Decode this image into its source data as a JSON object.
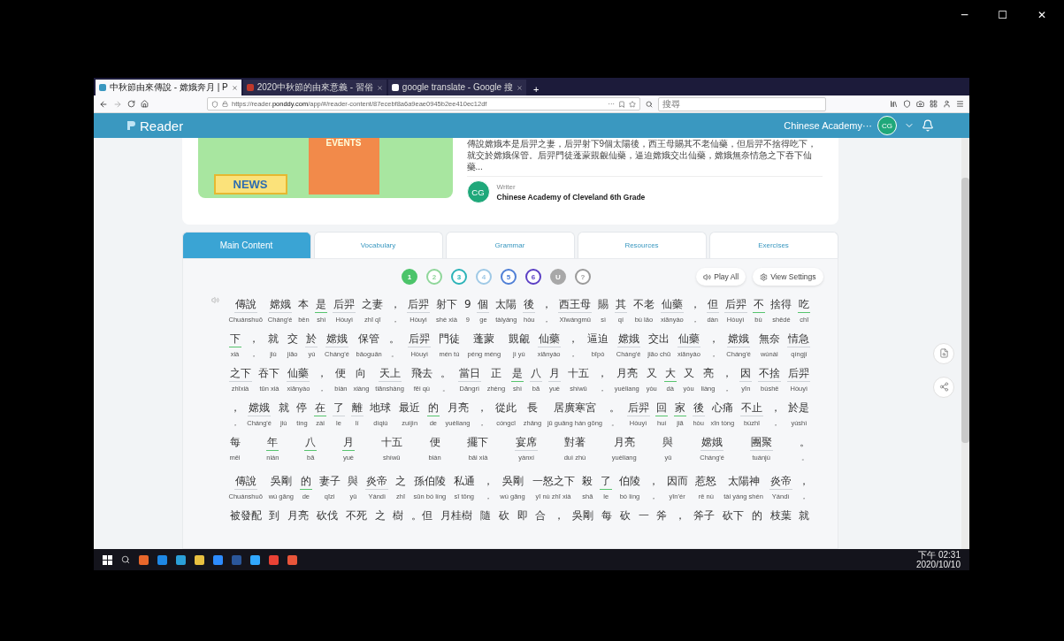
{
  "window_controls": [
    "─",
    "☐",
    "✕"
  ],
  "browser": {
    "tabs": [
      {
        "title": "中秋節由來傳說 - 嫦娥奔月 | P",
        "selected": true
      },
      {
        "title": "2020中秋節的由來意義 - 習俗",
        "selected": false
      },
      {
        "title": "google translate - Google 搜",
        "selected": false
      }
    ],
    "new_tab": "+",
    "url_prefix": "https://reader.",
    "url_domain": "ponddy.com",
    "url_path": "/app/#/reader-content/87ecebf8a6a9eae0945b2ee410ec12df",
    "more": "···",
    "search": {
      "placeholder": "搜尋"
    }
  },
  "header": {
    "logo": "Reader",
    "user": "Chinese Academy···",
    "avatar": "CG"
  },
  "article": {
    "illustration": [
      "NEWS",
      "EVENTS"
    ],
    "summary": "傳說嫦娥本是后羿之妻，后羿射下9個太陽後，西王母賜其不老仙藥，但后羿不捨得吃下，就交於嫦娥保管。后羿門徒蓬蒙覬覦仙藥，逼迫嫦娥交出仙藥，嫦娥無奈情急之下吞下仙藥...",
    "writer_label": "Writer",
    "writer_avatar": "CG",
    "writer": "Chinese Academy of Cleveland 6th Grade"
  },
  "tabs": [
    {
      "label": "Main Content",
      "selected": true
    },
    {
      "label": "Vocabulary",
      "selected": false
    },
    {
      "label": "Grammar",
      "selected": false
    },
    {
      "label": "Resources",
      "selected": false
    },
    {
      "label": "Exercises",
      "selected": false
    }
  ],
  "levels": [
    {
      "label": "1",
      "color": "#4cc46a",
      "selected": true
    },
    {
      "label": "2",
      "color": "#8fd69a",
      "selected": false
    },
    {
      "label": "3",
      "color": "#2bb3b8",
      "selected": false
    },
    {
      "label": "4",
      "color": "#9fc9e6",
      "selected": false
    },
    {
      "label": "5",
      "color": "#4f7fd6",
      "selected": false
    },
    {
      "label": "6",
      "color": "#5b3fc4",
      "selected": false
    },
    {
      "label": "U",
      "color": "#a8a8a8",
      "selected": true
    },
    {
      "label": "?",
      "color": "#9a9a9a",
      "selected": false
    }
  ],
  "play_all": "Play All",
  "view_settings": "View Settings",
  "paragraphs": [
    {
      "lines": [
        [
          {
            "h": "傳說",
            "p": "Chuánshuō",
            "kind": "vocab"
          },
          {
            "h": "嫦娥",
            "p": "Cháng'é",
            "kind": "vocab"
          },
          {
            "h": "本",
            "p": "běn",
            "kind": "plain"
          },
          {
            "h": "是",
            "p": "shì",
            "kind": "grammar"
          },
          {
            "h": "后羿",
            "p": "Hòuyì",
            "kind": "vocab"
          },
          {
            "h": "之妻",
            "p": "zhī qī",
            "kind": "plain"
          },
          {
            "h": "，",
            "p": "，",
            "kind": "plain"
          },
          {
            "h": "后羿",
            "p": "Hòuyì",
            "kind": "vocab"
          },
          {
            "h": "射下",
            "p": "shè xià",
            "kind": "plain"
          },
          {
            "h": "9",
            "p": "9",
            "kind": "plain"
          },
          {
            "h": "個",
            "p": "ge",
            "kind": "vocab"
          },
          {
            "h": "太陽",
            "p": "tàiyáng",
            "kind": "plain"
          },
          {
            "h": "後",
            "p": "hòu",
            "kind": "vocab"
          },
          {
            "h": "，",
            "p": "，",
            "kind": "plain"
          },
          {
            "h": "西王母",
            "p": "Xīwángmǔ",
            "kind": "vocab"
          },
          {
            "h": "賜",
            "p": "sì",
            "kind": "plain"
          },
          {
            "h": "其",
            "p": "qí",
            "kind": "vocab"
          },
          {
            "h": "不老",
            "p": "bù lǎo",
            "kind": "plain"
          },
          {
            "h": "仙藥",
            "p": "xiānyào",
            "kind": "vocab"
          },
          {
            "h": "，",
            "p": "，",
            "kind": "plain"
          },
          {
            "h": "但",
            "p": "dàn",
            "kind": "vocab"
          },
          {
            "h": "后羿",
            "p": "Hòuyì",
            "kind": "vocab"
          },
          {
            "h": "不",
            "p": "bù",
            "kind": "grammar"
          },
          {
            "h": "捨得",
            "p": "shědé",
            "kind": "plain"
          },
          {
            "h": "吃",
            "p": "chī",
            "kind": "grammar"
          }
        ],
        [
          {
            "h": "下",
            "p": "xià",
            "kind": "grammar"
          },
          {
            "h": "，",
            "p": "，",
            "kind": "plain"
          },
          {
            "h": "就",
            "p": "jiù",
            "kind": "plain"
          },
          {
            "h": "交",
            "p": "jiāo",
            "kind": "plain"
          },
          {
            "h": "於",
            "p": "yú",
            "kind": "vocab"
          },
          {
            "h": "嫦娥",
            "p": "Cháng'é",
            "kind": "vocab"
          },
          {
            "h": "保管",
            "p": "bǎoguǎn",
            "kind": "plain"
          },
          {
            "h": "。",
            "p": "。",
            "kind": "plain"
          },
          {
            "h": "后羿",
            "p": "Hòuyì",
            "kind": "vocab"
          },
          {
            "h": "門徒",
            "p": "mén tú",
            "kind": "plain"
          },
          {
            "h": "蓬蒙",
            "p": "péng méng",
            "kind": "plain"
          },
          {
            "h": "覬覦",
            "p": "jì yú",
            "kind": "plain"
          },
          {
            "h": "仙藥",
            "p": "xiānyào",
            "kind": "vocab"
          },
          {
            "h": "，",
            "p": "，",
            "kind": "plain"
          },
          {
            "h": "逼迫",
            "p": "bīpò",
            "kind": "plain"
          },
          {
            "h": "嫦娥",
            "p": "Cháng'é",
            "kind": "vocab"
          },
          {
            "h": "交出",
            "p": "jiāo chū",
            "kind": "plain"
          },
          {
            "h": "仙藥",
            "p": "xiānyào",
            "kind": "vocab"
          },
          {
            "h": "，",
            "p": "，",
            "kind": "plain"
          },
          {
            "h": "嫦娥",
            "p": "Cháng'é",
            "kind": "vocab"
          },
          {
            "h": "無奈",
            "p": "wúnài",
            "kind": "plain"
          },
          {
            "h": "情急",
            "p": "qíngjí",
            "kind": "vocab"
          }
        ],
        [
          {
            "h": "之下",
            "p": "zhīxià",
            "kind": "vocab"
          },
          {
            "h": "吞下",
            "p": "tūn xià",
            "kind": "plain"
          },
          {
            "h": "仙藥",
            "p": "xiānyào",
            "kind": "vocab"
          },
          {
            "h": "，",
            "p": "，",
            "kind": "plain"
          },
          {
            "h": "便",
            "p": "biàn",
            "kind": "plain"
          },
          {
            "h": "向",
            "p": "xiàng",
            "kind": "plain"
          },
          {
            "h": "天上",
            "p": "tiānshàng",
            "kind": "vocab"
          },
          {
            "h": "飛去",
            "p": "fēi qù",
            "kind": "plain"
          },
          {
            "h": "。",
            "p": "。",
            "kind": "plain"
          },
          {
            "h": "當日",
            "p": "Dāngrì",
            "kind": "vocab"
          },
          {
            "h": "正",
            "p": "zhèng",
            "kind": "plain"
          },
          {
            "h": "是",
            "p": "shì",
            "kind": "grammar"
          },
          {
            "h": "八",
            "p": "bā",
            "kind": "vocab"
          },
          {
            "h": "月",
            "p": "yuè",
            "kind": "vocab"
          },
          {
            "h": "十五",
            "p": "shíwǔ",
            "kind": "plain"
          },
          {
            "h": "，",
            "p": "，",
            "kind": "plain"
          },
          {
            "h": "月亮",
            "p": "yuèliang",
            "kind": "plain"
          },
          {
            "h": "又",
            "p": "yòu",
            "kind": "plain"
          },
          {
            "h": "大",
            "p": "dà",
            "kind": "grammar"
          },
          {
            "h": "又",
            "p": "yòu",
            "kind": "plain"
          },
          {
            "h": "亮",
            "p": "liàng",
            "kind": "plain"
          },
          {
            "h": "，",
            "p": "，",
            "kind": "plain"
          },
          {
            "h": "因",
            "p": "yīn",
            "kind": "vocab"
          },
          {
            "h": "不捨",
            "p": "bùshě",
            "kind": "vocab"
          },
          {
            "h": "后羿",
            "p": "Hòuyì",
            "kind": "vocab"
          }
        ],
        [
          {
            "h": "，",
            "p": "，",
            "kind": "plain"
          },
          {
            "h": "嫦娥",
            "p": "Cháng'é",
            "kind": "vocab"
          },
          {
            "h": "就",
            "p": "jiù",
            "kind": "plain"
          },
          {
            "h": "停",
            "p": "tíng",
            "kind": "plain"
          },
          {
            "h": "在",
            "p": "zài",
            "kind": "grammar"
          },
          {
            "h": "了",
            "p": "le",
            "kind": "vocab"
          },
          {
            "h": "離",
            "p": "lí",
            "kind": "vocab"
          },
          {
            "h": "地球",
            "p": "dìqiú",
            "kind": "plain"
          },
          {
            "h": "最近",
            "p": "zuìjìn",
            "kind": "plain"
          },
          {
            "h": "的",
            "p": "de",
            "kind": "grammar"
          },
          {
            "h": "月亮",
            "p": "yuèliang",
            "kind": "plain"
          },
          {
            "h": "，",
            "p": "，",
            "kind": "plain"
          },
          {
            "h": "從此",
            "p": "cóngcǐ",
            "kind": "plain"
          },
          {
            "h": "長",
            "p": "zhǎng",
            "kind": "plain"
          },
          {
            "h": "居廣寒宮",
            "p": "jū guǎng hán gōng",
            "kind": "plain"
          },
          {
            "h": "。",
            "p": "。",
            "kind": "plain"
          },
          {
            "h": "后羿",
            "p": "Hòuyì",
            "kind": "vocab"
          },
          {
            "h": "回",
            "p": "huí",
            "kind": "grammar"
          },
          {
            "h": "家",
            "p": "jiā",
            "kind": "grammar"
          },
          {
            "h": "後",
            "p": "hòu",
            "kind": "vocab"
          },
          {
            "h": "心痛",
            "p": "xīn tòng",
            "kind": "plain"
          },
          {
            "h": "不止",
            "p": "bùzhǐ",
            "kind": "vocab"
          },
          {
            "h": "，",
            "p": "，",
            "kind": "plain"
          },
          {
            "h": "於是",
            "p": "yúshì",
            "kind": "plain"
          }
        ],
        [
          {
            "h": "每",
            "p": "měi",
            "kind": "plain"
          },
          {
            "h": "年",
            "p": "nián",
            "kind": "grammar"
          },
          {
            "h": "八",
            "p": "bā",
            "kind": "grammar"
          },
          {
            "h": "月",
            "p": "yuè",
            "kind": "grammar"
          },
          {
            "h": "十五",
            "p": "shíwǔ",
            "kind": "plain"
          },
          {
            "h": "便",
            "p": "biàn",
            "kind": "plain"
          },
          {
            "h": "擺下",
            "p": "bǎi xià",
            "kind": "plain"
          },
          {
            "h": "宴席",
            "p": "yànxí",
            "kind": "vocab"
          },
          {
            "h": "對著",
            "p": "duì zhù",
            "kind": "plain"
          },
          {
            "h": "月亮",
            "p": "yuèliang",
            "kind": "plain"
          },
          {
            "h": "與",
            "p": "yǔ",
            "kind": "plain"
          },
          {
            "h": "嫦娥",
            "p": "Cháng'é",
            "kind": "vocab"
          },
          {
            "h": "團聚",
            "p": "tuánjù",
            "kind": "vocab"
          },
          {
            "h": "。",
            "p": "。",
            "kind": "plain"
          }
        ]
      ]
    },
    {
      "lines": [
        [
          {
            "h": "傳說",
            "p": "Chuánshuō",
            "kind": "vocab"
          },
          {
            "h": "吳剛",
            "p": "wú gāng",
            "kind": "plain"
          },
          {
            "h": "的",
            "p": "de",
            "kind": "grammar"
          },
          {
            "h": "妻子",
            "p": "qīzi",
            "kind": "plain"
          },
          {
            "h": "與",
            "p": "yǔ",
            "kind": "plain"
          },
          {
            "h": "炎帝",
            "p": "Yándì",
            "kind": "vocab"
          },
          {
            "h": "之",
            "p": "zhī",
            "kind": "plain"
          },
          {
            "h": "孫伯陵",
            "p": "sūn bó líng",
            "kind": "plain"
          },
          {
            "h": "私通",
            "p": "sī tōng",
            "kind": "plain"
          },
          {
            "h": "，",
            "p": "，",
            "kind": "plain"
          },
          {
            "h": "吳剛",
            "p": "wú gāng",
            "kind": "plain"
          },
          {
            "h": "一怒之下",
            "p": "yī nù zhī xià",
            "kind": "plain"
          },
          {
            "h": "殺",
            "p": "shā",
            "kind": "plain"
          },
          {
            "h": "了",
            "p": "le",
            "kind": "grammar"
          },
          {
            "h": "伯陵",
            "p": "bó líng",
            "kind": "plain"
          },
          {
            "h": "，",
            "p": "，",
            "kind": "plain"
          },
          {
            "h": "因而",
            "p": "yīn'ér",
            "kind": "plain"
          },
          {
            "h": "惹怒",
            "p": "rě nù",
            "kind": "plain"
          },
          {
            "h": "太陽神",
            "p": "tài yáng shén",
            "kind": "plain"
          },
          {
            "h": "炎帝",
            "p": "Yándì",
            "kind": "vocab"
          },
          {
            "h": "，",
            "p": "，",
            "kind": "plain"
          }
        ],
        [
          {
            "h": "被發配",
            "kind": "plain"
          },
          {
            "h": "到",
            "kind": "plain"
          },
          {
            "h": "月亮",
            "kind": "plain"
          },
          {
            "h": "砍伐",
            "kind": "plain"
          },
          {
            "h": "不死",
            "kind": "plain"
          },
          {
            "h": "之",
            "kind": "plain"
          },
          {
            "h": "樹",
            "kind": "plain"
          },
          {
            "h": "。但",
            "kind": "plain"
          },
          {
            "h": "月桂樹",
            "kind": "plain"
          },
          {
            "h": "隨",
            "kind": "plain"
          },
          {
            "h": "砍",
            "kind": "plain"
          },
          {
            "h": "即",
            "kind": "plain"
          },
          {
            "h": "合",
            "kind": "plain"
          },
          {
            "h": "，",
            "kind": "plain"
          },
          {
            "h": "吳剛",
            "kind": "plain"
          },
          {
            "h": "每",
            "kind": "plain"
          },
          {
            "h": "砍",
            "kind": "plain"
          },
          {
            "h": "一",
            "kind": "plain"
          },
          {
            "h": "斧",
            "kind": "plain"
          },
          {
            "h": "，",
            "kind": "plain"
          },
          {
            "h": "斧子",
            "kind": "plain"
          },
          {
            "h": "砍下",
            "kind": "plain"
          },
          {
            "h": "的",
            "kind": "plain"
          },
          {
            "h": "枝葉",
            "kind": "plain"
          },
          {
            "h": "就",
            "kind": "plain"
          }
        ]
      ]
    }
  ],
  "taskbar": {
    "time": "下午 02:31",
    "date": "2020/10/10"
  }
}
